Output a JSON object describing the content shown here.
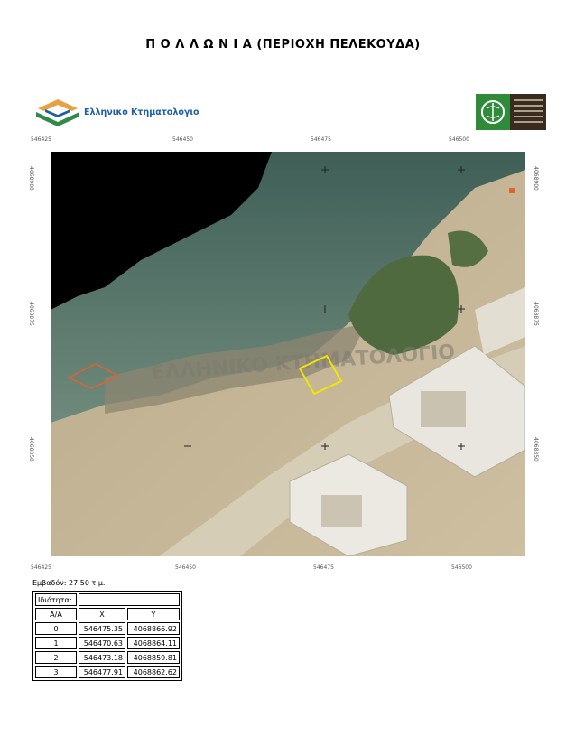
{
  "title": "Π Ο Λ Λ Ω Ν Ι Α (ΠΕΡΙΟΧΗ ΠΕΛΕΚΟΥΔΑ)",
  "logo_text": "Ελληνικο Κτηματολογιο",
  "watermark": "ΕΛΛΗΝΙΚΟ ΚΤΗΜΑΤΟΛΟΓΙΟ",
  "map": {
    "top_ticks": [
      "546425",
      "546450",
      "546475",
      "546500"
    ],
    "bottom_ticks": [
      "546425",
      "546450",
      "546475",
      "546500"
    ],
    "left_ticks": [
      "4068900",
      "4068875",
      "4068850"
    ],
    "right_ticks": [
      "4068900",
      "4068875",
      "4068850"
    ],
    "parcel_color": "#f2e600",
    "other_parcel_color": "#e0622e"
  },
  "area_label": "Εμβαδόν: 27.50 τ.μ.",
  "table": {
    "property_label": "Ιδιότητα:",
    "property_value": "",
    "headers": [
      "Α/Α",
      "X",
      "Y"
    ],
    "rows": [
      [
        "0",
        "546475.35",
        "4068866.92"
      ],
      [
        "1",
        "546470.63",
        "4068864.11"
      ],
      [
        "2",
        "546473.18",
        "4068859.81"
      ],
      [
        "3",
        "546477.91",
        "4068862.62"
      ]
    ]
  }
}
